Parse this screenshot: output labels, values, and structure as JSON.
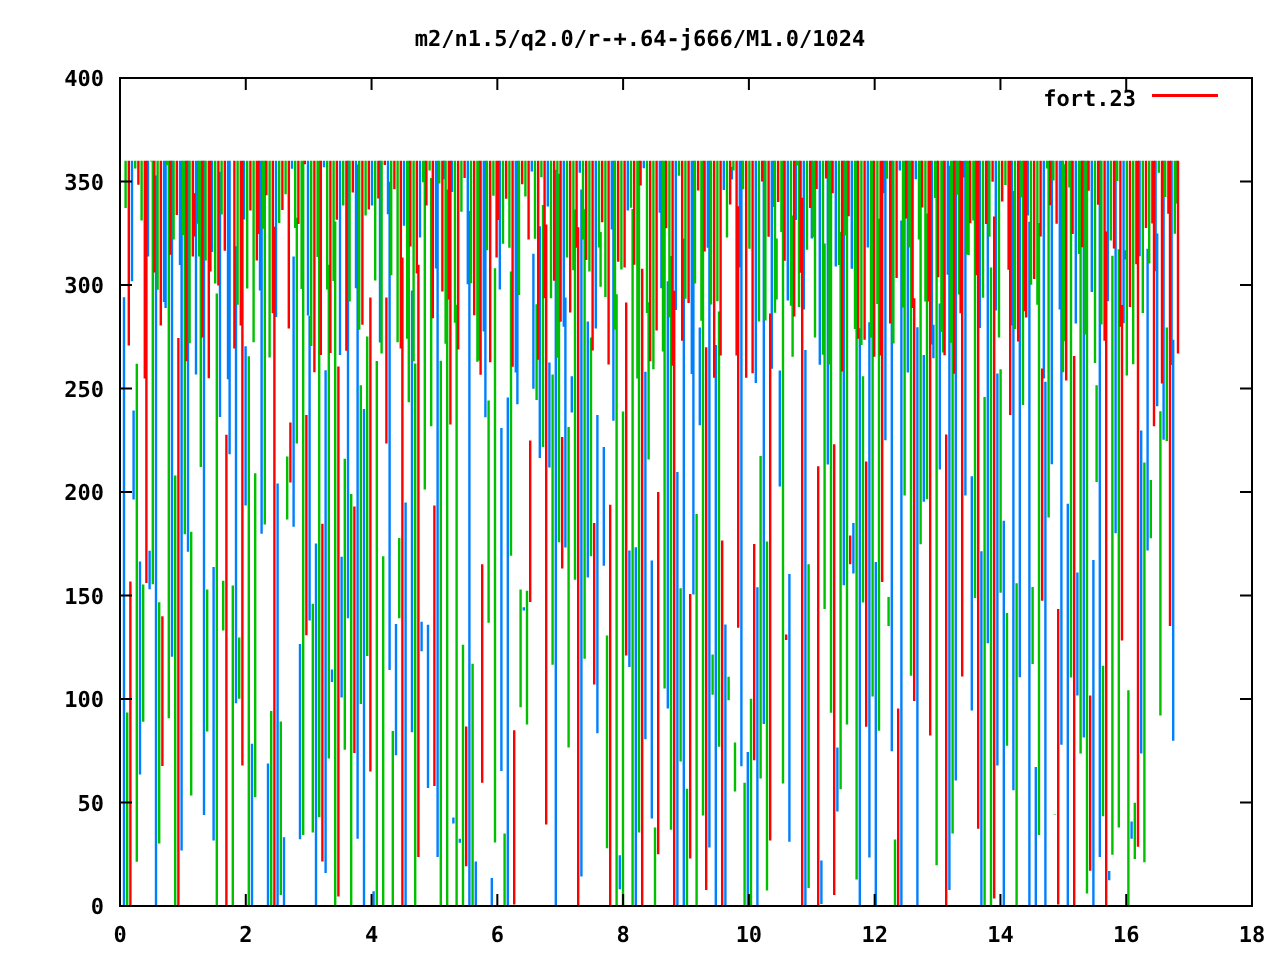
{
  "title": "m2/n1.5/q2.0/r-+.64-j666/M1.0/1024",
  "y_axis": {
    "ticks": [
      "400",
      "350",
      "300",
      "250",
      "200",
      "150",
      "100",
      "50",
      "0"
    ]
  },
  "x_axis": {
    "ticks": [
      "0",
      "2",
      "4",
      "6",
      "8",
      "10",
      "12",
      "14",
      "16",
      "18"
    ]
  },
  "legend": {
    "label": "fort.23",
    "color": "#ff0000"
  }
}
